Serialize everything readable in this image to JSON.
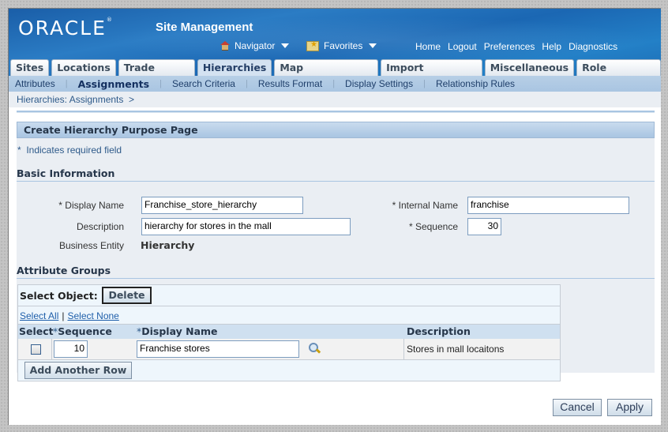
{
  "header": {
    "logo": "ORACLE",
    "app_title": "Site Management",
    "navigator_label": "Navigator",
    "favorites_label": "Favorites",
    "global_links": [
      "Home",
      "Logout",
      "Preferences",
      "Help",
      "Diagnostics"
    ]
  },
  "tabs": [
    {
      "label": "Sites",
      "active": false
    },
    {
      "label": "Locations",
      "active": false
    },
    {
      "label": "Trade Areas",
      "active": false
    },
    {
      "label": "Hierarchies",
      "active": true
    },
    {
      "label": "Map Preferences",
      "active": false
    },
    {
      "label": "Import Interface",
      "active": false
    },
    {
      "label": "Miscellaneous",
      "active": false
    },
    {
      "label": "Role Security",
      "active": false
    }
  ],
  "subtabs": [
    {
      "label": "Attributes",
      "active": false
    },
    {
      "label": "Assignments",
      "active": true
    },
    {
      "label": "Search Criteria",
      "active": false
    },
    {
      "label": "Results Format",
      "active": false
    },
    {
      "label": "Display Settings",
      "active": false
    },
    {
      "label": "Relationship Rules",
      "active": false
    }
  ],
  "breadcrumb": "Hierarchies: Assignments  >",
  "page": {
    "title": "Create Hierarchy Purpose Page",
    "required_note": "*  Indicates required field",
    "basic_info": {
      "section_title": "Basic Information",
      "display_name_label": "* Display Name",
      "display_name_value": "Franchise_store_hierarchy",
      "description_label": "Description",
      "description_value": "hierarchy for stores in the mall",
      "business_entity_label": "Business Entity",
      "business_entity_value": "Hierarchy",
      "internal_name_label": "* Internal Name",
      "internal_name_value": "franchise",
      "sequence_label": "* Sequence",
      "sequence_value": "30"
    },
    "attribute_groups": {
      "section_title": "Attribute Groups",
      "select_object_label": "Select Object:",
      "delete_label": "Delete",
      "select_all": "Select All",
      "select_none": "Select None",
      "columns": {
        "select": "Select",
        "sequence": "Sequence",
        "display_name": "Display Name",
        "description": "Description",
        "required_mark": "*"
      },
      "rows": [
        {
          "checked": false,
          "sequence": "10",
          "display_name": "Franchise stores",
          "description": "Stores in mall locaitons"
        }
      ],
      "add_row_label": "Add Another Row"
    },
    "actions": {
      "cancel": "Cancel",
      "apply": "Apply"
    }
  }
}
